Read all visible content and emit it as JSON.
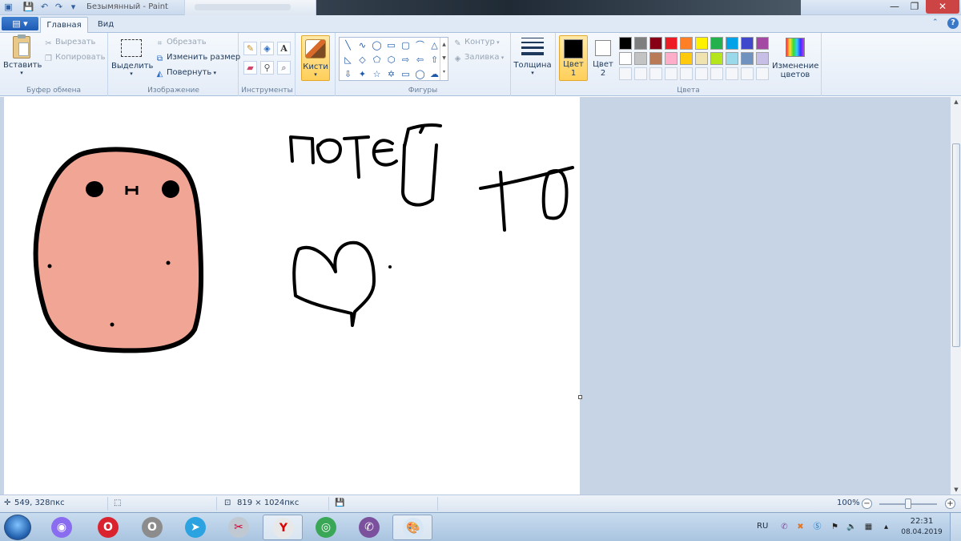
{
  "window": {
    "title": "Безымянный - Paint",
    "quick_access": [
      "save-icon",
      "undo-icon",
      "redo-icon",
      "customize-icon"
    ],
    "controls": {
      "minimize": "—",
      "maximize": "❐",
      "close": "✕"
    }
  },
  "ribbon": {
    "file_label": "▤ ▾",
    "tabs": {
      "home": "Главная",
      "view": "Вид"
    },
    "help": "?",
    "clipboard": {
      "label": "Буфер обмена",
      "paste": "Вставить",
      "cut": "Вырезать",
      "copy": "Копировать"
    },
    "image": {
      "label": "Изображение",
      "select": "Выделить",
      "crop": "Обрезать",
      "resize": "Изменить размер",
      "rotate": "Повернуть"
    },
    "tools": {
      "label": "Инструменты",
      "text_glyph": "A"
    },
    "brushes": {
      "label": "Кисти"
    },
    "shapes": {
      "label": "Фигуры",
      "glyphs": [
        "╲",
        "∿",
        "◯",
        "▭",
        "▢",
        "⌒",
        "△",
        "◺",
        "◇",
        "⬠",
        "⬡",
        "⇨",
        "⇦",
        "⇧",
        "⇩",
        "✦",
        "☆",
        "✡",
        "▭",
        "◯",
        "☁"
      ],
      "outline": "Контур",
      "fill": "Заливка"
    },
    "size": {
      "label": "Толщина"
    },
    "colors": {
      "label": "Цвета",
      "color1_line1": "Цвет",
      "color1_line2": "1",
      "color2_line1": "Цвет",
      "color2_line2": "2",
      "edit_line1": "Изменение",
      "edit_line2": "цветов",
      "row1": [
        "#000000",
        "#7f7f7f",
        "#880015",
        "#ed1c24",
        "#ff7f27",
        "#fff200",
        "#22b14c",
        "#00a2e8",
        "#3f48cc",
        "#a349a4"
      ],
      "row2": [
        "#ffffff",
        "#c3c3c3",
        "#b97a57",
        "#ffaec9",
        "#ffc90e",
        "#efe4b0",
        "#b5e61d",
        "#99d9ea",
        "#7092be",
        "#c8bfe7"
      ]
    }
  },
  "canvas": {
    "drawing_fill": "#f0a595",
    "stroke": "#000000"
  },
  "statusbar": {
    "cursor_pos": "549, 328пкс",
    "image_size": "819 × 1024пкс",
    "zoom": "100%",
    "zoom_out": "−",
    "zoom_in": "+"
  },
  "taskbar": {
    "apps": [
      {
        "name": "alice",
        "glyph": "◉",
        "color": "#8a6cf0"
      },
      {
        "name": "opera",
        "glyph": "O",
        "color": "#d9232e"
      },
      {
        "name": "opera-gx",
        "glyph": "O",
        "color": "#8c8c8c"
      },
      {
        "name": "telegram",
        "glyph": "➤",
        "color": "#2aa3e0"
      },
      {
        "name": "snipping-tool",
        "glyph": "✂",
        "color": "#c0c8d2"
      },
      {
        "name": "yandex-browser",
        "glyph": "Y",
        "color": "#e8e8e8"
      },
      {
        "name": "chrome",
        "glyph": "◎",
        "color": "#3aa757"
      },
      {
        "name": "viber",
        "glyph": "✆",
        "color": "#7b519d"
      },
      {
        "name": "paint",
        "glyph": "🎨",
        "color": "#d6e6f5"
      }
    ],
    "lang": "RU",
    "time": "22:31",
    "date": "08.04.2019"
  }
}
